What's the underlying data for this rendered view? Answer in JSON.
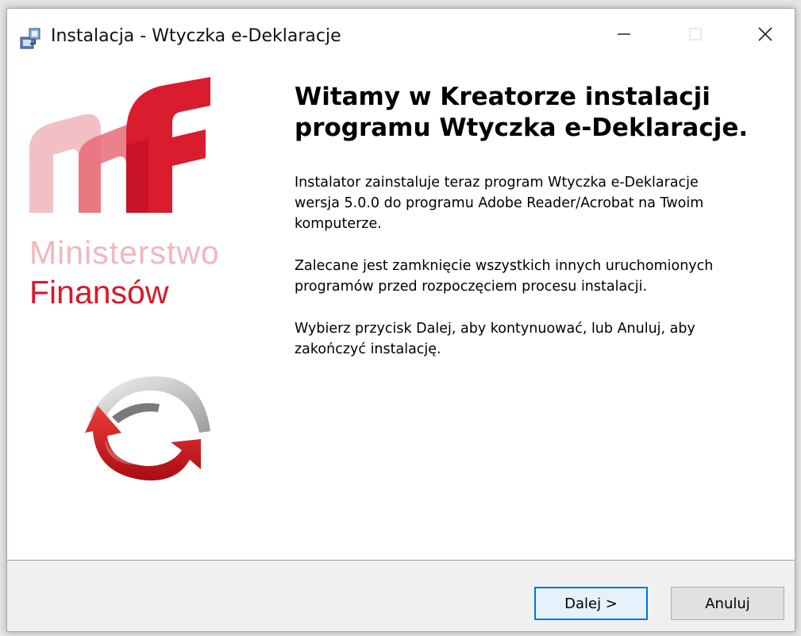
{
  "window": {
    "title": "Instalacja - Wtyczka e-Deklaracje"
  },
  "title_controls": {
    "minimize_icon": "minimize-icon",
    "maximize_icon": "maximize-icon",
    "close_icon": "close-icon"
  },
  "branding": {
    "line1": "Ministerstwo",
    "line2": "Finansów",
    "logo_icon": "mf-logo-icon",
    "e_icon": "e-deklaracje-logo-icon"
  },
  "main": {
    "heading_line1": "Witamy w Kreatorze instalacji",
    "heading_line2": "programu Wtyczka e-Deklaracje.",
    "paragraph1_line1": "Instalator zainstaluje teraz program Wtyczka e-Deklaracje",
    "paragraph1_line2": "wersja 5.0.0 do programu Adobe Reader/Acrobat na Twoim",
    "paragraph1_line3": "komputerze.",
    "paragraph2_line1": "Zalecane jest zamknięcie wszystkich innych uruchomionych",
    "paragraph2_line2": "programów przed rozpoczęciem procesu instalacji.",
    "paragraph3_line1": "Wybierz przycisk Dalej, aby kontynuować, lub Anuluj, aby",
    "paragraph3_line2": "zakończyć instalację."
  },
  "buttons": {
    "next_label": "Dalej >",
    "cancel_label": "Anuluj"
  },
  "colors": {
    "brand_red": "#d8182b",
    "brand_pink": "#f0b7bc",
    "focus_blue": "#0078d7"
  }
}
